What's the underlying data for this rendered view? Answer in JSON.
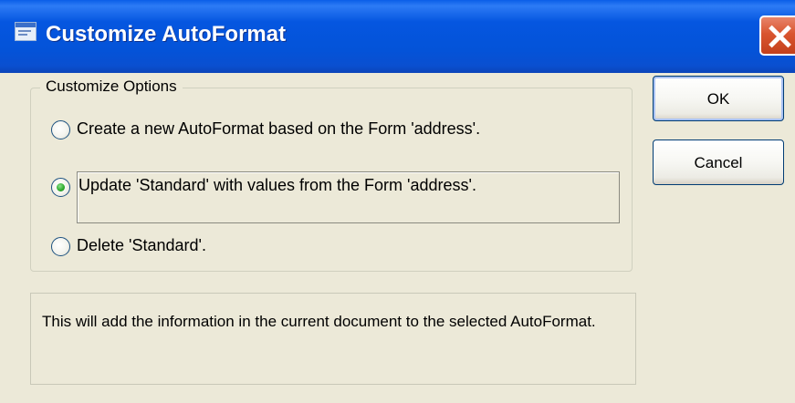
{
  "window": {
    "title": "Customize AutoFormat",
    "title_icon": "form-icon",
    "close_icon": "close-icon"
  },
  "group": {
    "legend": "Customize Options",
    "options": [
      {
        "label": "Create a new AutoFormat based on the Form 'address'.",
        "selected": false
      },
      {
        "label": "Update 'Standard' with values from the Form 'address'.",
        "selected": true
      },
      {
        "label": "Delete 'Standard'.",
        "selected": false
      }
    ]
  },
  "description": "This will add the information in the current document to the selected AutoFormat.",
  "buttons": {
    "ok": "OK",
    "cancel": "Cancel"
  },
  "colors": {
    "titlebar": "#0453d8",
    "dialog_bg": "#ece9d8",
    "close_button": "#d9552f",
    "radio_selected": "#2fae2f"
  }
}
